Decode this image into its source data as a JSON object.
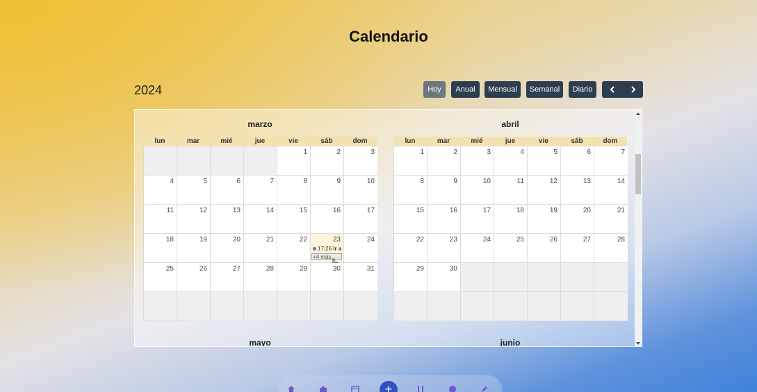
{
  "page": {
    "title": "Calendario",
    "year": "2024"
  },
  "toolbar": {
    "today": "Hoy",
    "views": [
      "Anual",
      "Mensual",
      "Semanal",
      "Diario"
    ],
    "prev_icon": "chevron-left-icon",
    "next_icon": "chevron-right-icon"
  },
  "weekdays": [
    "lun",
    "mar",
    "mié",
    "jue",
    "vie",
    "sáb",
    "dom"
  ],
  "months": [
    {
      "name": "marzo",
      "weeks": [
        [
          "",
          "",
          "",
          "",
          "1",
          "2",
          "3"
        ],
        [
          "4",
          "5",
          "6",
          "7",
          "8",
          "9",
          "10"
        ],
        [
          "11",
          "12",
          "13",
          "14",
          "15",
          "16",
          "17"
        ],
        [
          "18",
          "19",
          "20",
          "21",
          "22",
          "23",
          "24"
        ],
        [
          "25",
          "26",
          "27",
          "28",
          "29",
          "30",
          "31"
        ],
        [
          "",
          "",
          "",
          "",
          "",
          "",
          ""
        ]
      ],
      "today": "23",
      "event": {
        "day": "23",
        "time": "17:26",
        "title": "Ir a",
        "more": "+4 más"
      }
    },
    {
      "name": "abril",
      "weeks": [
        [
          "1",
          "2",
          "3",
          "4",
          "5",
          "6",
          "7"
        ],
        [
          "8",
          "9",
          "10",
          "11",
          "12",
          "13",
          "14"
        ],
        [
          "15",
          "16",
          "17",
          "18",
          "19",
          "20",
          "21"
        ],
        [
          "22",
          "23",
          "24",
          "25",
          "26",
          "27",
          "28"
        ],
        [
          "29",
          "30",
          "",
          "",
          "",
          "",
          ""
        ],
        [
          "",
          "",
          "",
          "",
          "",
          "",
          ""
        ]
      ]
    }
  ],
  "next_months": [
    "mayo",
    "junio"
  ],
  "bottom_nav": {
    "icons": [
      "home-icon",
      "briefcase-icon",
      "calendar-icon",
      "add-icon",
      "tools-icon",
      "user-icon",
      "edit-icon"
    ],
    "add_label": "+"
  }
}
